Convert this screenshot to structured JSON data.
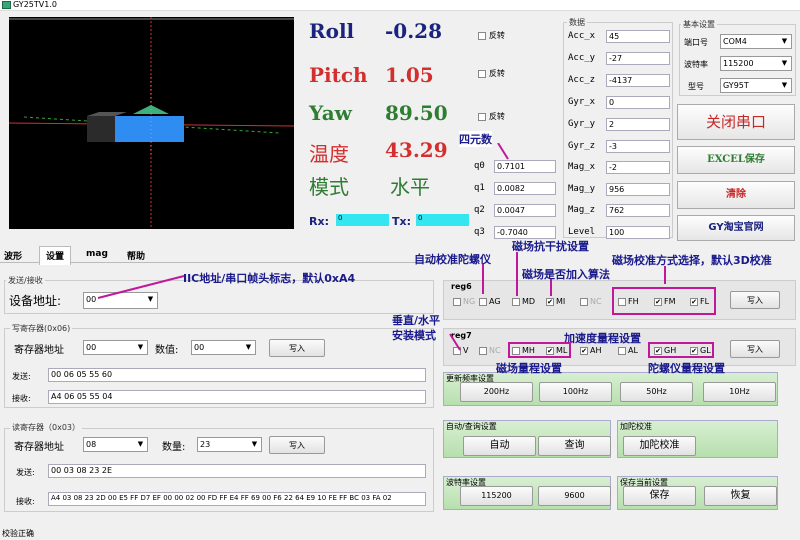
{
  "window": {
    "title": "GY25TV1.0"
  },
  "attitude": {
    "roll_label": "Roll",
    "roll_value": "-0.28",
    "roll_invert": "反转",
    "pitch_label": "Pitch",
    "pitch_value": "1.05",
    "pitch_invert": "反转",
    "yaw_label": "Yaw",
    "yaw_value": "89.50",
    "yaw_invert": "反转",
    "temp_label": "温度",
    "temp_value": "43.29",
    "mode_label": "模式",
    "mode_value": "水平",
    "rx_label": "Rx:",
    "rx_value": "0",
    "tx_label": "Tx:",
    "tx_value": "0"
  },
  "quaternion": {
    "title": "四元数",
    "rows": [
      {
        "label": "q0",
        "value": "0.7101"
      },
      {
        "label": "q1",
        "value": "0.0082"
      },
      {
        "label": "q2",
        "value": "0.0047"
      },
      {
        "label": "q3",
        "value": "-0.7040"
      }
    ]
  },
  "sensor_data": {
    "title": "数据",
    "rows": [
      {
        "label": "Acc_x",
        "value": "45"
      },
      {
        "label": "Acc_y",
        "value": "-27"
      },
      {
        "label": "Acc_z",
        "value": "-4137"
      },
      {
        "label": "Gyr_x",
        "value": "0"
      },
      {
        "label": "Gyr_y",
        "value": "2"
      },
      {
        "label": "Gyr_z",
        "value": "-3"
      },
      {
        "label": "Mag_x",
        "value": "-2"
      },
      {
        "label": "Mag_y",
        "value": "956"
      },
      {
        "label": "Mag_z",
        "value": "762"
      },
      {
        "label": "Level",
        "value": "100"
      }
    ]
  },
  "basic_settings": {
    "title": "基本设置",
    "port_label": "端口号",
    "port_value": "COM4",
    "baud_label": "波特率",
    "baud_value": "115200",
    "model_label": "型号",
    "model_value": "GY95T"
  },
  "actions": {
    "close_port": "关闭串口",
    "excel_save": "EXCEL保存",
    "clear": "清除",
    "shop": "GY淘宝官网"
  },
  "tabs": [
    "波形",
    "设置",
    "mag",
    "帮助"
  ],
  "send_receive": {
    "title": "发送/接收",
    "device_addr_label": "设备地址:",
    "device_addr_value": "00"
  },
  "write_reg": {
    "title": "写寄存器(0x06)",
    "addr_label": "寄存器地址",
    "addr_value": "00",
    "value_label": "数值:",
    "value_value": "00",
    "write_btn": "写入",
    "send_label": "发送:",
    "send_value": "00 06 05 55 60",
    "recv_label": "接收:",
    "recv_value": "A4 06 05 55 04"
  },
  "read_reg": {
    "title": "读寄存器（0x03）",
    "addr_label": "寄存器地址",
    "addr_value": "08",
    "count_label": "数量:",
    "count_value": "23",
    "write_btn": "写入",
    "send_label": "发送:",
    "send_value": "00 03 08 23 2E",
    "recv_label": "接收:",
    "recv_value": "A4 03 08 23 2D 00 E5 FF D7 EF 00 00 02 00 FD FF E4 FF 69 00 F6 22 64 E9 10 FE FF BC 03 FA 02"
  },
  "reg6": {
    "title": "reg6",
    "checks": [
      {
        "label": "NG",
        "checked": false,
        "disabled": true
      },
      {
        "label": "AG",
        "checked": false
      },
      {
        "label": "MD",
        "checked": false
      },
      {
        "label": "MI",
        "checked": true
      },
      {
        "label": "NC",
        "checked": false,
        "disabled": true
      },
      {
        "label": "FH",
        "checked": false
      },
      {
        "label": "FM",
        "checked": true
      },
      {
        "label": "FL",
        "checked": true
      }
    ],
    "write_btn": "写入"
  },
  "reg7": {
    "title": "reg7",
    "checks": [
      {
        "label": "V",
        "checked": false
      },
      {
        "label": "NC",
        "checked": false,
        "disabled": true
      },
      {
        "label": "MH",
        "checked": false
      },
      {
        "label": "ML",
        "checked": true
      },
      {
        "label": "AH",
        "checked": true
      },
      {
        "label": "AL",
        "checked": false
      },
      {
        "label": "GH",
        "checked": true
      },
      {
        "label": "GL",
        "checked": true
      }
    ],
    "write_btn": "写入"
  },
  "update_rate": {
    "title": "更新频率设置",
    "buttons": [
      "200Hz",
      "100Hz",
      "50Hz",
      "10Hz"
    ]
  },
  "auto_query": {
    "title": "自动/查询设置",
    "auto": "自动",
    "query": "查询"
  },
  "accel_cal": {
    "title": "加陀校准",
    "button": "加陀校准"
  },
  "baud_set": {
    "title": "波特率设置",
    "b1": "115200",
    "b2": "9600"
  },
  "save_params": {
    "title": "保存当前设置",
    "save": "保存",
    "restore": "恢复"
  },
  "annotations": {
    "iic": "IIC地址/串口帧头标志，默认0xA4",
    "auto_gyro": "自动校准陀螺仪",
    "mag_anti": "磁场抗干扰设置",
    "mag_algo": "磁场是否加入算法",
    "mag_cal": "磁场校准方式选择，默认3D校准",
    "install": "垂直/水平\n安装模式",
    "accel_range": "加速度量程设置",
    "mag_range": "磁场量程设置",
    "gyro_range": "陀螺仪量程设置"
  },
  "status": "校验正确",
  "colors": {
    "roll": "#1a237e",
    "pitch": "#d32f2f",
    "yaw": "#2e7d32",
    "annotation": "#1a1a8c",
    "highlight": "#c0189b",
    "cube": "#2f8cf0"
  }
}
